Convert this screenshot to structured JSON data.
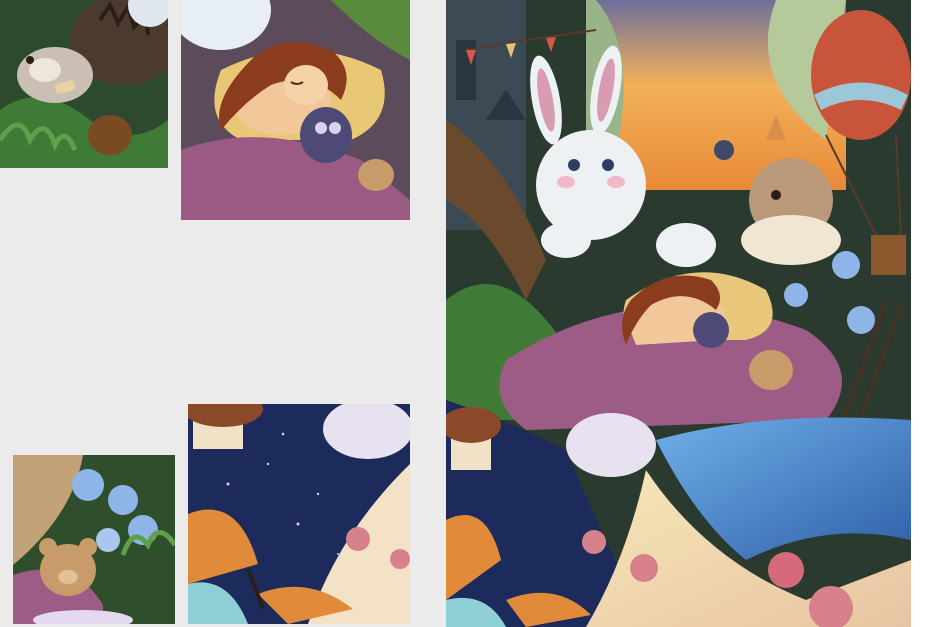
{
  "collage": {
    "tiles": [
      {
        "id": "top-left",
        "subject": "hedgehog-with-bandage-detail"
      },
      {
        "id": "top-mid",
        "subject": "sleeping-girl-hugging-owl-detail"
      },
      {
        "id": "main",
        "subject": "full-fairytale-painting"
      },
      {
        "id": "bot-left",
        "subject": "teddy-bear-bluebells-detail"
      },
      {
        "id": "bot-mid",
        "subject": "butterfly-starry-cloud-detail"
      }
    ]
  },
  "palette": {
    "sky_orange": "#f2a24a",
    "sky_purple": "#6e5a8f",
    "pillow_yellow": "#e9c77a",
    "blanket_purple": "#9c5c86",
    "river_blue": "#4f93d6",
    "night_blue": "#1d2a5c",
    "grass_green": "#3e7a3a",
    "balloon_red": "#c8553b"
  }
}
